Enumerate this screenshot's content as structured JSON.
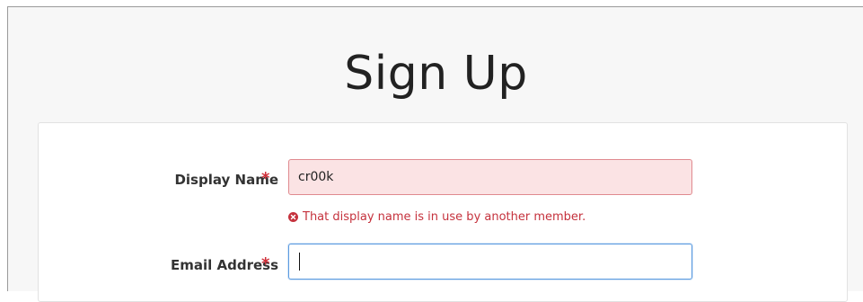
{
  "page": {
    "title": "Sign Up"
  },
  "form": {
    "fields": [
      {
        "label": "Display Name",
        "required_marker": "*",
        "value": "cr00k",
        "error": "That display name is in use by another member."
      },
      {
        "label": "Email Address",
        "required_marker": "*",
        "value": ""
      }
    ]
  },
  "icons": {
    "error": "error-circle-x-icon"
  },
  "colors": {
    "error_text": "#c5323d",
    "error_bg": "#fbe3e4",
    "required_star": "#d0303a",
    "focus_border": "#5b9be0"
  }
}
